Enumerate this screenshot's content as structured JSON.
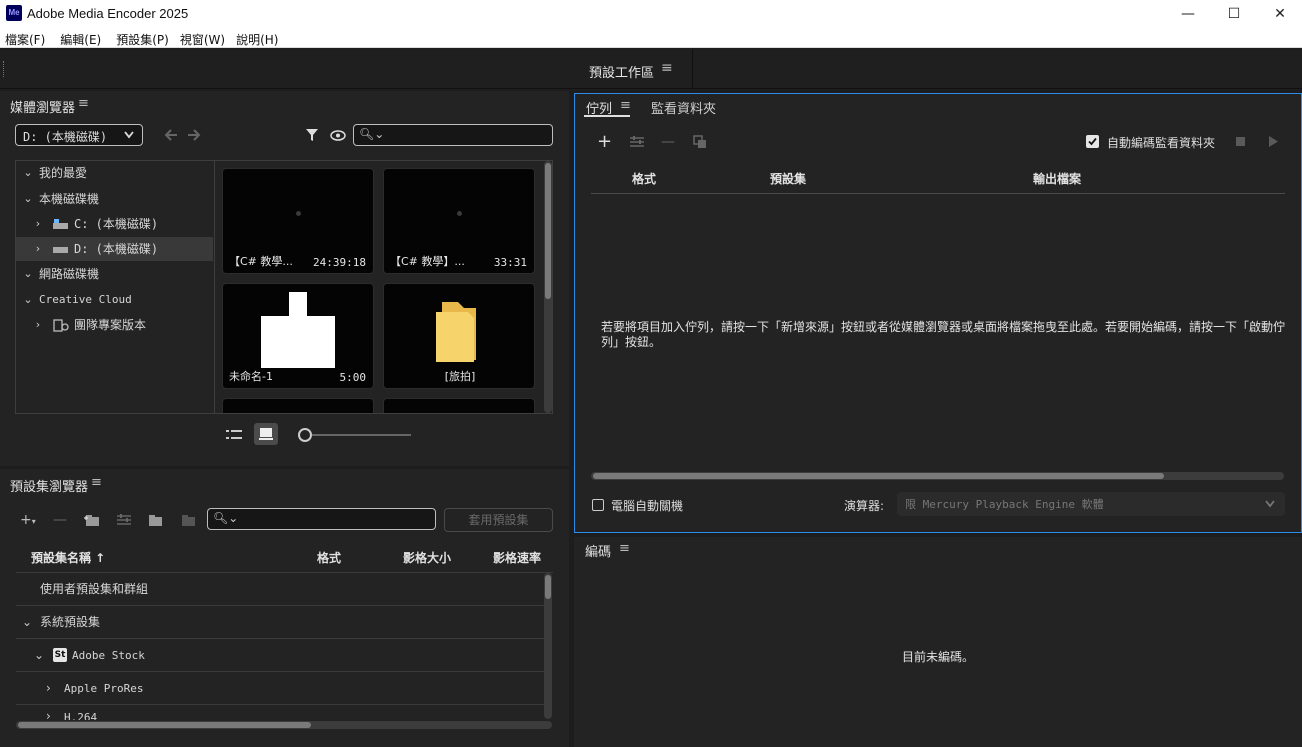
{
  "app": {
    "title": "Adobe Media Encoder 2025",
    "logo_text": "Me",
    "window_controls": {
      "minimize": "—",
      "maximize": "☐",
      "close": "✕"
    }
  },
  "menu": [
    "檔案(F)",
    "編輯(E)",
    "預設集(P)",
    "視窗(W)",
    "說明(H)"
  ],
  "workspace": {
    "name": "預設工作區",
    "menu_icon": "≡"
  },
  "media_browser": {
    "title": "媒體瀏覽器",
    "drive_select": "D: (本機磁碟)",
    "tree": [
      {
        "label": "我的最愛",
        "expanded": true,
        "level": 0
      },
      {
        "label": "本機磁碟機",
        "expanded": true,
        "level": 0
      },
      {
        "label": "C: (本機磁碟)",
        "expanded": false,
        "level": 1
      },
      {
        "label": "D: (本機磁碟)",
        "expanded": false,
        "level": 1,
        "selected": true
      },
      {
        "label": "網路磁碟機",
        "expanded": true,
        "level": 0
      },
      {
        "label": "Creative Cloud",
        "expanded": true,
        "level": 0
      },
      {
        "label": "團隊專案版本",
        "expanded": false,
        "level": 1
      }
    ],
    "thumbs": [
      {
        "label": "【C# 教學...",
        "duration": "24:39:18"
      },
      {
        "label": "【C# 教學】...",
        "duration": "33:31"
      },
      {
        "label": "未命名-1",
        "duration": "5:00"
      },
      {
        "label": "[旅拍]",
        "duration": ""
      }
    ]
  },
  "queue": {
    "tab_active": "佇列",
    "tab_other": "監看資料夾",
    "auto_encode_label": "自動編碼監看資料夾",
    "auto_encode_checked": true,
    "columns": [
      "格式",
      "預設集",
      "輸出檔案"
    ],
    "empty_message": "若要將項目加入佇列，請按一下「新增來源」按鈕或者從媒體瀏覽器或桌面將檔案拖曳至此處。若要開始編碼，請按一下「啟動佇列」按鈕。",
    "shutdown_label": "電腦自動關機",
    "renderer_label": "演算器:",
    "renderer_value": "限 Mercury Playback Engine 軟體"
  },
  "preset_browser": {
    "title": "預設集瀏覽器",
    "apply_button": "套用預設集",
    "columns": [
      "預設集名稱 ↑",
      "格式",
      "影格大小",
      "影格速率"
    ],
    "rows": [
      {
        "label": "使用者預設集和群組",
        "level": 0,
        "chevron": ""
      },
      {
        "label": "系統預設集",
        "level": 0,
        "chevron": "down"
      },
      {
        "label": "Adobe Stock",
        "level": 1,
        "chevron": "down",
        "badge": "St"
      },
      {
        "label": "Apple ProRes",
        "level": 2,
        "chevron": "right"
      },
      {
        "label": "H.264",
        "level": 2,
        "chevron": "right"
      }
    ]
  },
  "encoding": {
    "title": "編碼",
    "empty_message": "目前未編碼。"
  },
  "colors": {
    "accent": "#2d8ceb",
    "panel_bg": "#232323",
    "folder": "#f6d36b"
  }
}
